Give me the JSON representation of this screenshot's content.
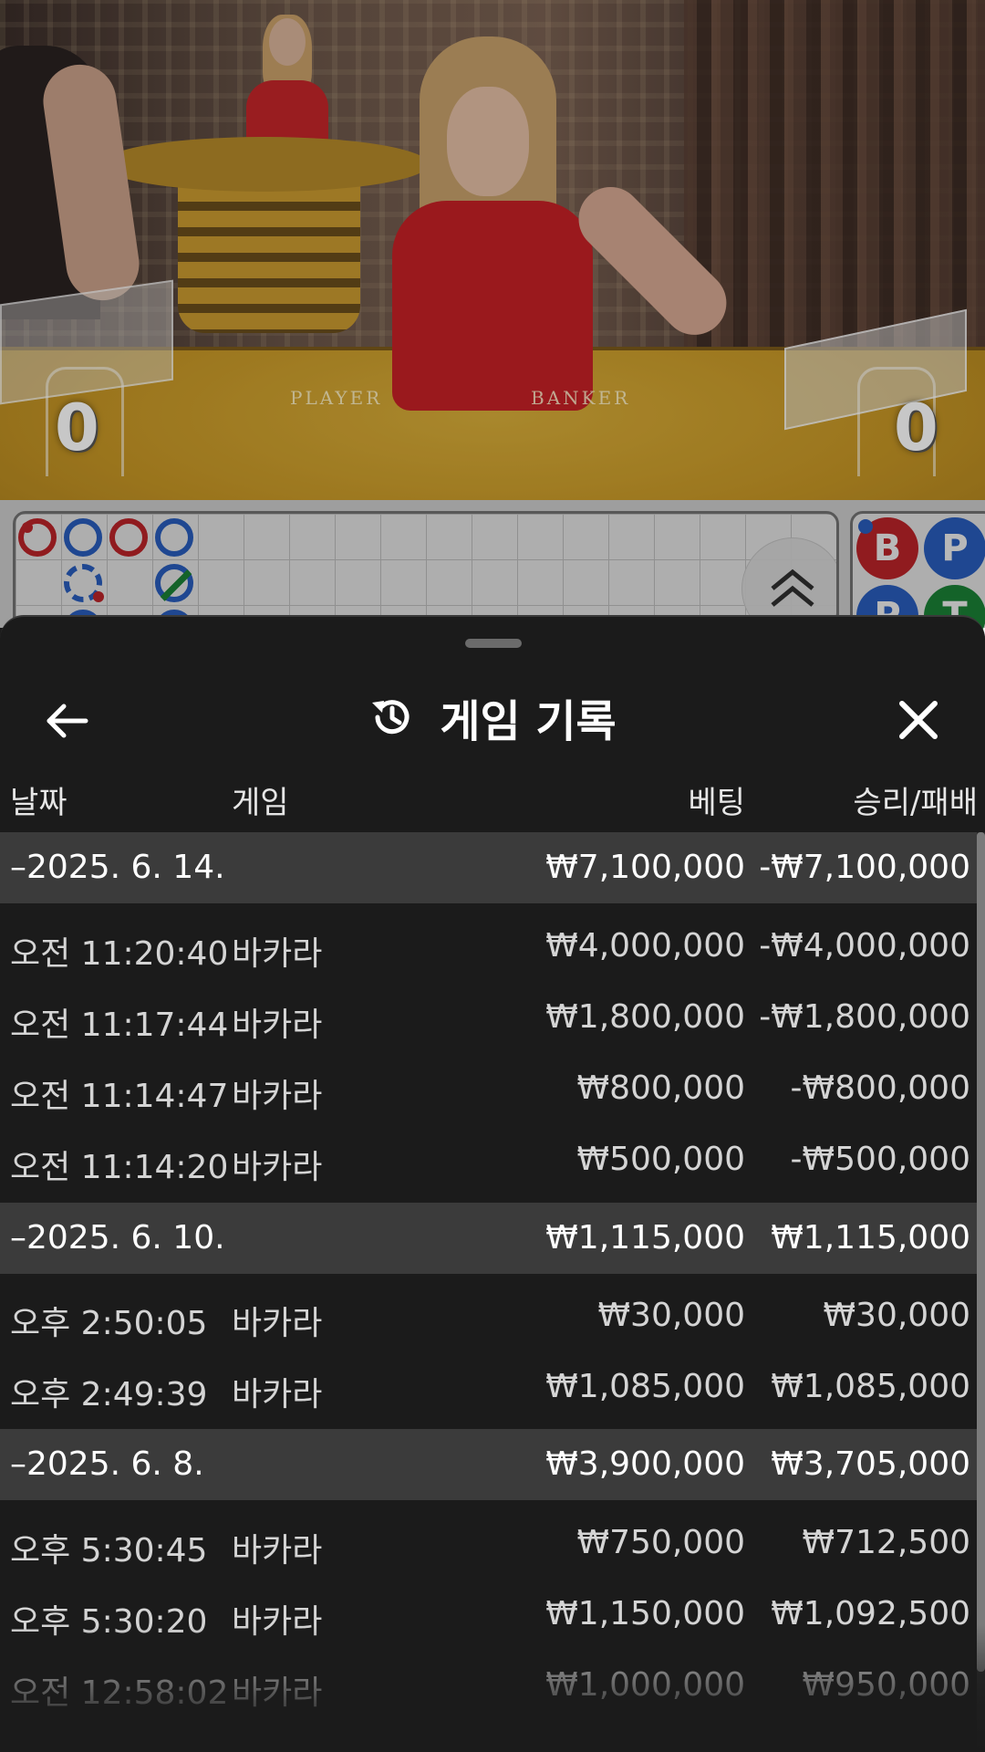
{
  "video": {
    "table_labels": [
      "PLAYER",
      "BANKER"
    ],
    "player_score": "0",
    "banker_score": "0"
  },
  "roads": {
    "side_pills": [
      "B",
      "P",
      "P",
      "T"
    ]
  },
  "sheet": {
    "title": "게임 기록",
    "columns": {
      "date": "날짜",
      "game": "게임",
      "bet": "베팅",
      "result": "승리/패배"
    },
    "groups": [
      {
        "date": "–2025. 6. 14.",
        "bet": "₩7,100,000",
        "result": "-₩7,100,000",
        "items": [
          {
            "time": "오전 11:20:40",
            "game": "바카라",
            "bet": "₩4,000,000",
            "result": "-₩4,000,000"
          },
          {
            "time": "오전 11:17:44",
            "game": "바카라",
            "bet": "₩1,800,000",
            "result": "-₩1,800,000"
          },
          {
            "time": "오전 11:14:47",
            "game": "바카라",
            "bet": "₩800,000",
            "result": "-₩800,000"
          },
          {
            "time": "오전 11:14:20",
            "game": "바카라",
            "bet": "₩500,000",
            "result": "-₩500,000"
          }
        ]
      },
      {
        "date": "–2025. 6. 10.",
        "bet": "₩1,115,000",
        "result": "₩1,115,000",
        "items": [
          {
            "time": "오후 2:50:05",
            "game": "바카라",
            "bet": "₩30,000",
            "result": "₩30,000"
          },
          {
            "time": "오후 2:49:39",
            "game": "바카라",
            "bet": "₩1,085,000",
            "result": "₩1,085,000"
          }
        ]
      },
      {
        "date": "–2025. 6. 8.",
        "bet": "₩3,900,000",
        "result": "₩3,705,000",
        "items": [
          {
            "time": "오후 5:30:45",
            "game": "바카라",
            "bet": "₩750,000",
            "result": "₩712,500"
          },
          {
            "time": "오후 5:30:20",
            "game": "바카라",
            "bet": "₩1,150,000",
            "result": "₩1,092,500"
          },
          {
            "time": "오전 12:58:02",
            "game": "바카라",
            "bet": "₩1,000,000",
            "result": "₩950,000"
          }
        ]
      }
    ]
  },
  "colors": {
    "sheet_bg": "#1b1b1b",
    "group_bg": "#3b3b3b",
    "banker_red": "#c8262b",
    "player_blue": "#2b63c9",
    "tie_green": "#1d8a3a"
  }
}
